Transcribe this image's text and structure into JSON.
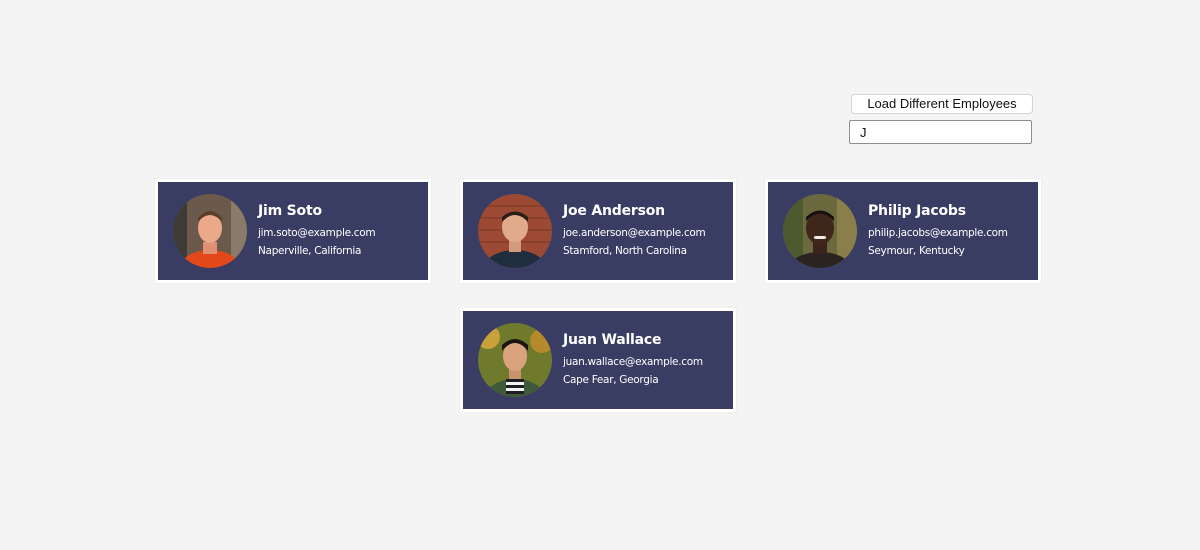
{
  "controls": {
    "load_button_label": "Load Different Employees",
    "filter_value": "J"
  },
  "employees": [
    {
      "name": "Jim Soto",
      "email": "jim.soto@example.com",
      "location": "Naperville, California",
      "avatar_icon": "person-photo-avatar"
    },
    {
      "name": "Joe Anderson",
      "email": "joe.anderson@example.com",
      "location": "Stamford, North Carolina",
      "avatar_icon": "person-photo-avatar"
    },
    {
      "name": "Philip Jacobs",
      "email": "philip.jacobs@example.com",
      "location": "Seymour, Kentucky",
      "avatar_icon": "person-photo-avatar"
    },
    {
      "name": "Juan Wallace",
      "email": "juan.wallace@example.com",
      "location": "Cape Fear, Georgia",
      "avatar_icon": "person-photo-avatar"
    }
  ],
  "colors": {
    "page_background": "#f4f4f4",
    "card_background": "#3a3d63",
    "card_border": "#ffffff",
    "card_text": "#ffffff"
  }
}
